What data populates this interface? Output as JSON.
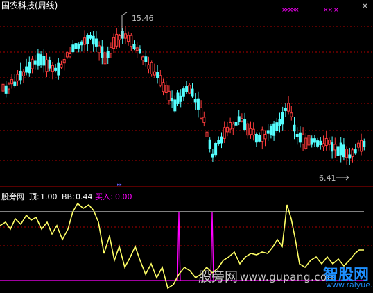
{
  "header": {
    "title": "国农科技(周线)",
    "title_color": "#ffffff",
    "close_icon": "close-icon"
  },
  "main_chart": {
    "high_label": "15.46",
    "low_label": "6.41",
    "label_color": "#c0c0c0",
    "up_color": "#ff3c3c",
    "down_color": "#54ffff",
    "marker_color": "#ff00ff",
    "signal_marks_top_right": [
      "×××××",
      "×× ×"
    ]
  },
  "indicator": {
    "name": "股旁网",
    "params": [
      {
        "label": "顶:",
        "value": "1.00",
        "color": "#ffffff"
      },
      {
        "label": "BB:",
        "value": "0.44",
        "color": "#ffffff"
      },
      {
        "label": "买入:",
        "value": "0.00",
        "color": "#ff00ff"
      }
    ],
    "line_color": "#ffff66",
    "top_line_color": "#ffffff",
    "bottom_line_color": "#ff00ff",
    "spike_color": "#ff00ff"
  },
  "watermarks": {
    "left_text": "股旁网",
    "url": "www.gupang.com",
    "brand": "智股网",
    "brand_url": "www.raiyue.com",
    "brand_color": "#1e90ff"
  }
}
